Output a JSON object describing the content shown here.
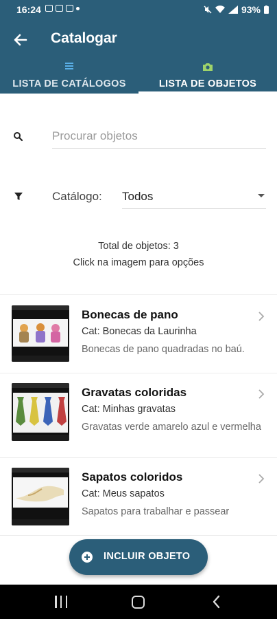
{
  "status_bar": {
    "time": "16:24",
    "battery": "93%"
  },
  "app_bar": {
    "title": "Catalogar"
  },
  "tabs": [
    {
      "label": "LISTA DE CATÁLOGOS",
      "icon": "list-icon",
      "active": false
    },
    {
      "label": "LISTA DE OBJETOS",
      "icon": "camera-icon",
      "active": true
    }
  ],
  "search": {
    "placeholder": "Procurar objetos",
    "value": ""
  },
  "filter": {
    "label": "Catálogo:",
    "selected": "Todos"
  },
  "summary": {
    "total": "Total de objetos: 3",
    "hint": "Click na imagem para opções"
  },
  "items": [
    {
      "title": "Bonecas de pano",
      "category": "Cat: Bonecas da Laurinha",
      "description": "Bonecas de pano quadradas no baú."
    },
    {
      "title": "Gravatas coloridas",
      "category": "Cat: Minhas gravatas",
      "description": "Gravatas verde amarelo azul e vermelha"
    },
    {
      "title": "Sapatos coloridos",
      "category": "Cat: Meus sapatos",
      "description": "Sapatos para trabalhar e passear"
    }
  ],
  "fab": {
    "label": "INCLUIR OBJETO"
  },
  "colors": {
    "primary": "#2b5e79",
    "tab_icon_list": "#5ab0e8",
    "tab_icon_camera": "#9fd36a"
  }
}
